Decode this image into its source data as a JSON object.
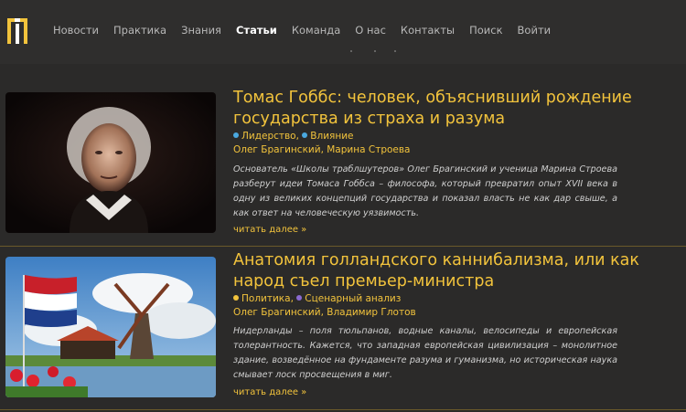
{
  "nav": {
    "items": [
      "Новости",
      "Практика",
      "Знания",
      "Статьи",
      "Команда",
      "О нас",
      "Контакты",
      "Поиск",
      "Войти"
    ],
    "active": "Статьи"
  },
  "articles": [
    {
      "title": "Томас Гоббс: человек, объяснивший рождение государства из страха и разума",
      "tags": [
        {
          "label": "Лидерство",
          "color": "#4aa8e0"
        },
        {
          "label": "Влияние",
          "color": "#4aa8e0"
        }
      ],
      "authors": [
        "Олег Брагинский",
        "Марина Строева"
      ],
      "excerpt": "Основатель «Школы траблшутеров» Олег Брагинский и ученица Марина Строева разберут идеи Томаса Гоббса – философа, который превратил опыт XVII века в одну из великих концепций государства и показал власть не как дар свыше, а как ответ на человеческую уязвимость.",
      "more": "читать далее »"
    },
    {
      "title": "Анатомия голландского каннибализма, или как народ съел премьер-министра",
      "tags": [
        {
          "label": "Политика",
          "color": "#f2c33c"
        },
        {
          "label": "Сценарный анализ",
          "color": "#8a6ad0"
        }
      ],
      "authors": [
        "Олег Брагинский",
        "Владимир Глотов"
      ],
      "excerpt": "Нидерланды – поля тюльпанов, водные каналы, велосипеды и европейская толерантность. Кажется, что западная европейская цивилизация – монолитное здание, возведённое на фундаменте разума и гуманизма, но историческая наука смывает лоск просвещения в миг.",
      "more": "читать далее »"
    }
  ],
  "colors": {
    "accent": "#f2c33c",
    "background": "#2b2a29",
    "divider": "#6b5a2a"
  }
}
